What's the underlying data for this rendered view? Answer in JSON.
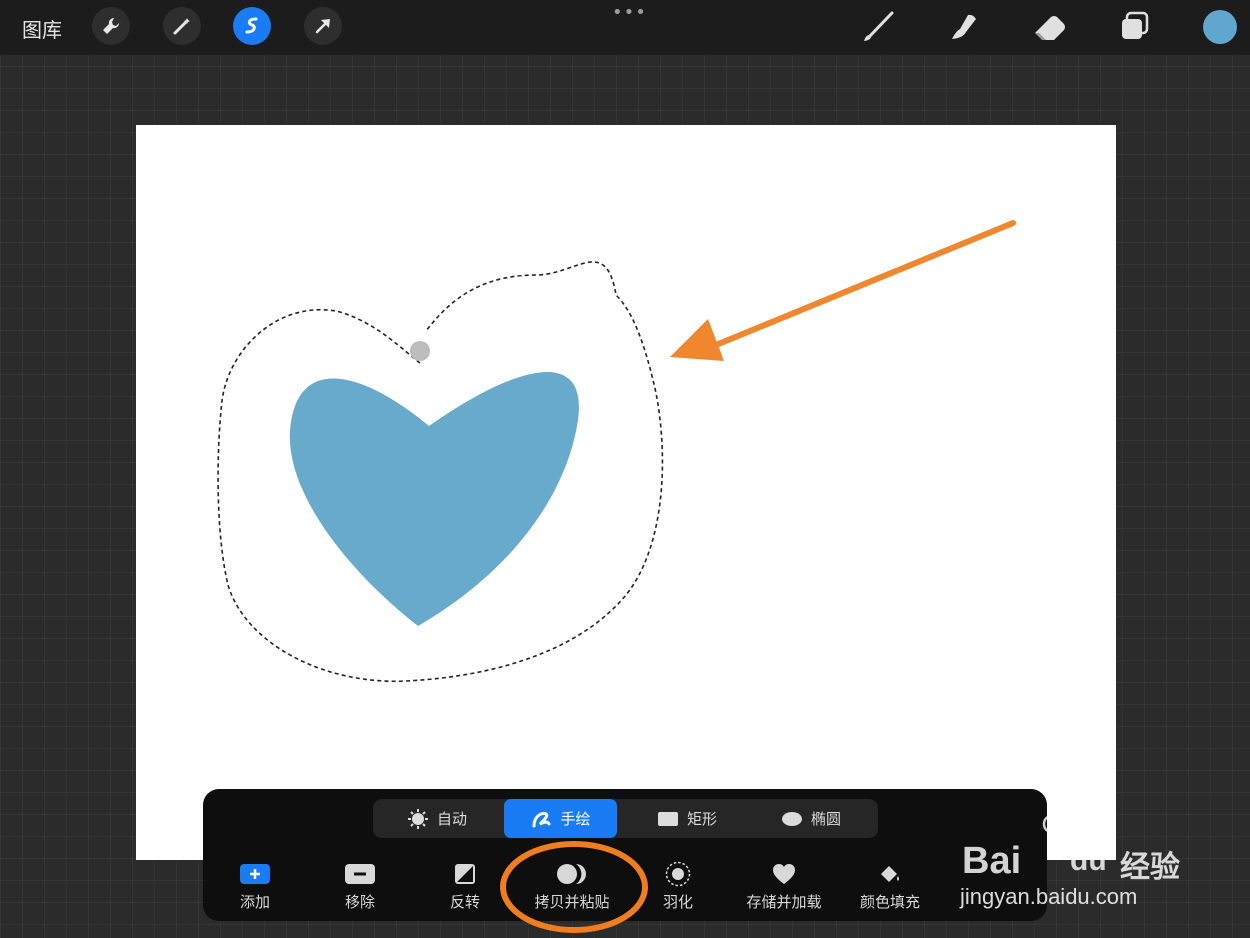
{
  "toolbar": {
    "gallery_label": "图库",
    "more_icon": "•••",
    "tools_left": [
      "wrench-icon",
      "magic-wand-icon",
      "selection-icon",
      "transform-arrow-icon"
    ],
    "active_tool": "selection-icon",
    "tools_right": [
      "brush-icon",
      "smudge-icon",
      "eraser-icon",
      "layers-icon"
    ],
    "current_color": "#5fa7cf"
  },
  "canvas": {
    "heart_color": "#67aacb",
    "arrow_color": "#f0862e"
  },
  "selection_modes": {
    "items": [
      {
        "label": "自动",
        "icon": "auto-sun-icon"
      },
      {
        "label": "手绘",
        "icon": "freehand-icon"
      },
      {
        "label": "矩形",
        "icon": "rectangle-icon"
      },
      {
        "label": "椭圆",
        "icon": "ellipse-icon"
      }
    ],
    "active": "手绘"
  },
  "actions": {
    "items": [
      {
        "label": "添加",
        "icon": "add-icon"
      },
      {
        "label": "移除",
        "icon": "remove-icon"
      },
      {
        "label": "反转",
        "icon": "invert-icon"
      },
      {
        "label": "拷贝并粘贴",
        "icon": "copy-paste-icon"
      },
      {
        "label": "羽化",
        "icon": "feather-icon"
      },
      {
        "label": "存储并加载",
        "icon": "heart-save-icon"
      },
      {
        "label": "颜色填充",
        "icon": "color-fill-icon"
      }
    ],
    "highlight_color": "#f07d1e"
  },
  "watermark": {
    "brand_bai": "Bai",
    "brand_du": "du",
    "brand_cn": "经验",
    "url": "jingyan.baidu.com"
  }
}
